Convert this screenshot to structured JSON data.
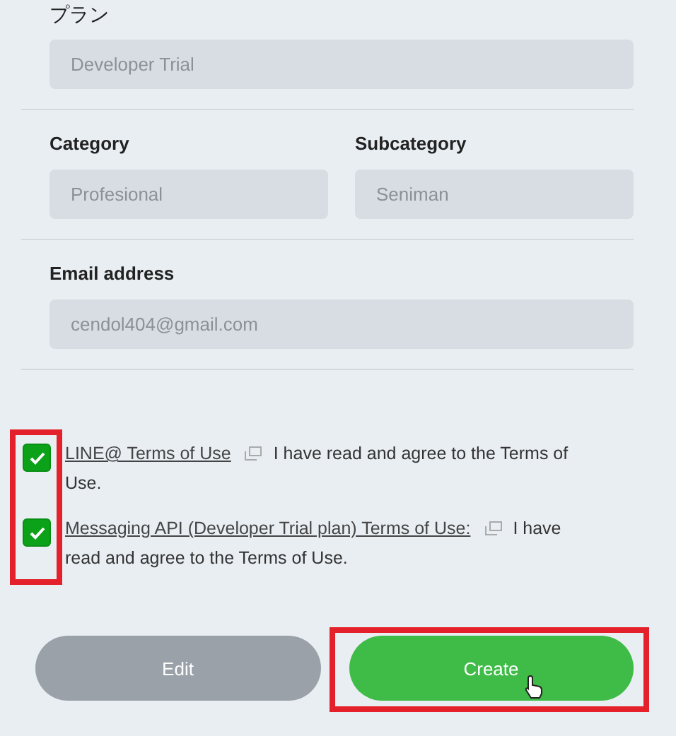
{
  "plan": {
    "label": "プラン",
    "value": "Developer Trial"
  },
  "category": {
    "label": "Category",
    "value": "Profesional"
  },
  "subcategory": {
    "label": "Subcategory",
    "value": "Seniman"
  },
  "email": {
    "label": "Email address",
    "value": "cendol404@gmail.com"
  },
  "terms": {
    "highlighted": true,
    "items": [
      {
        "link": "LINE@ Terms of Use",
        "text": "I have read and agree to the Terms of Use.",
        "checked": true
      },
      {
        "link": "Messaging API (Developer Trial plan) Terms of Use:",
        "text": "I have read and agree to the Terms of Use.",
        "checked": true
      }
    ]
  },
  "buttons": [
    {
      "label": "Edit",
      "kind": "secondary",
      "highlighted": false
    },
    {
      "label": "Create",
      "kind": "primary",
      "highlighted": true
    }
  ]
}
